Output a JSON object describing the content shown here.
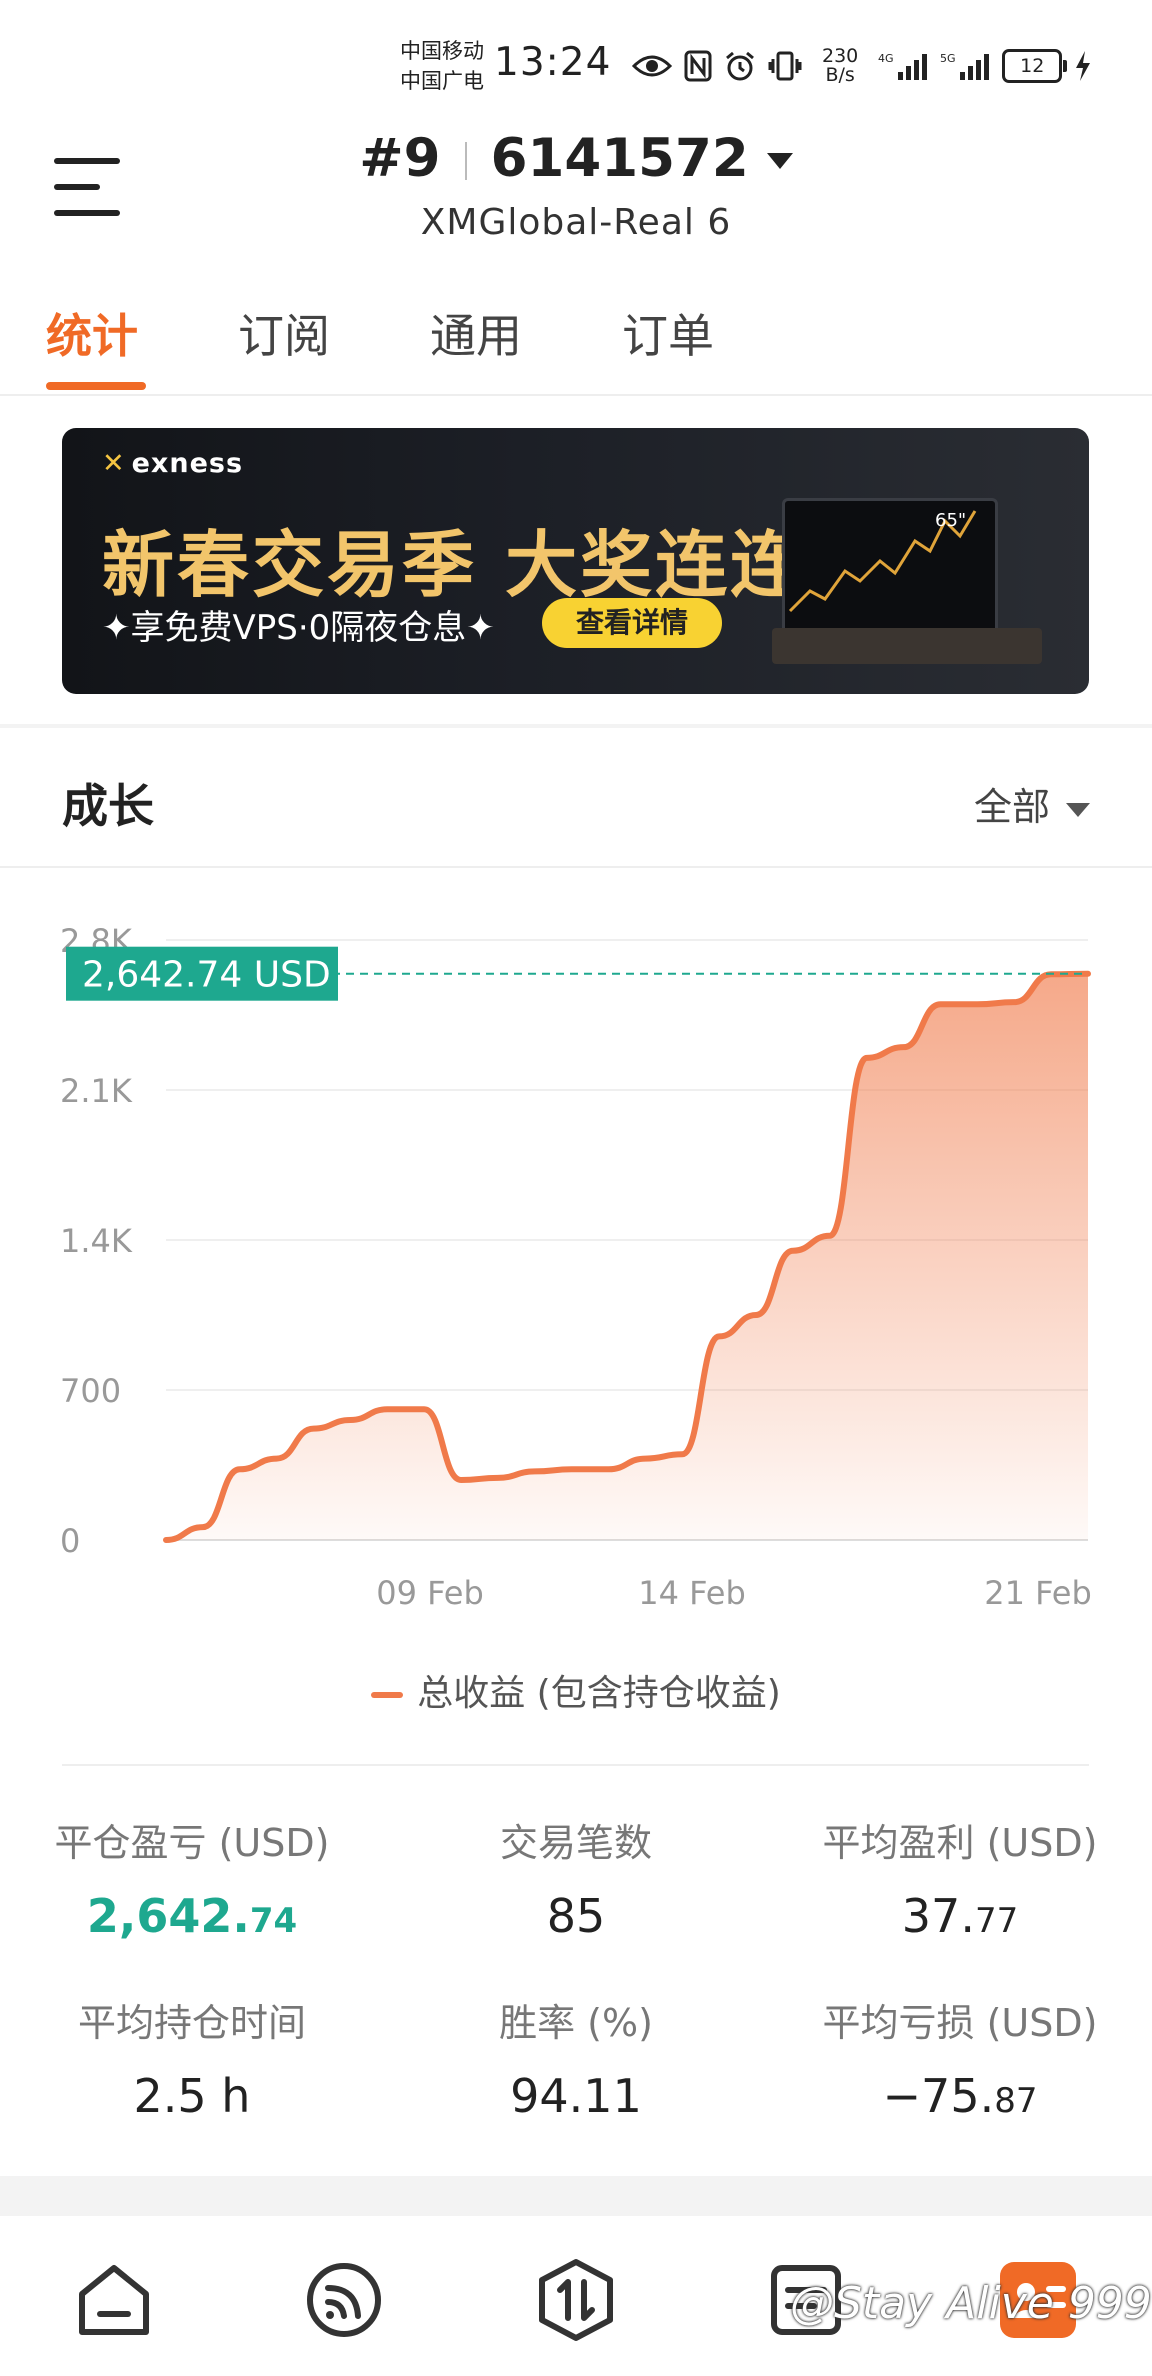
{
  "status_bar": {
    "carrier1": "中国移动",
    "carrier2": "中国广电",
    "time": "13:24",
    "net_speed_value": "230",
    "net_speed_unit": "B/s",
    "signal1": "4G",
    "signal2": "5G",
    "battery": "12"
  },
  "header": {
    "account_rank": "#9",
    "account_number": "6141572",
    "server": "XMGlobal-Real 6"
  },
  "tabs": [
    {
      "label": "统计",
      "active": true
    },
    {
      "label": "订阅",
      "active": false
    },
    {
      "label": "通用",
      "active": false
    },
    {
      "label": "订单",
      "active": false
    }
  ],
  "banner": {
    "brand": "exness",
    "title": "新春交易季 大奖连连抽",
    "subtitle": "✦享免费VPS·0隔夜仓息✦",
    "button": "查看详情",
    "tv_size": "65\""
  },
  "growth": {
    "title": "成长",
    "filter": "全部"
  },
  "chart_data": {
    "type": "area",
    "y_ticks": [
      "2.8K",
      "2.1K",
      "1.4K",
      "700",
      "0"
    ],
    "ylim": [
      0,
      2800
    ],
    "x_ticks": [
      "09 Feb",
      "14 Feb",
      "21 Feb"
    ],
    "current_label": "2,642.74 USD",
    "current_value": 2642.74,
    "series": [
      {
        "name": "总收益 (包含持仓收益)",
        "color": "#f07a4a",
        "values": [
          0,
          60,
          330,
          380,
          520,
          560,
          610,
          610,
          280,
          290,
          320,
          330,
          330,
          380,
          400,
          950,
          1050,
          1350,
          1420,
          2250,
          2300,
          2500,
          2500,
          2510,
          2640,
          2642.74
        ]
      }
    ]
  },
  "legend": {
    "label": "总收益 (包含持仓收益)"
  },
  "stats": {
    "closed_pnl": {
      "label": "平仓盈亏 (USD)",
      "int": "2,642.",
      "dec": "74"
    },
    "trades": {
      "label": "交易笔数",
      "int": "85",
      "dec": ""
    },
    "avg_profit": {
      "label": "平均盈利 (USD)",
      "int": "37.",
      "dec": "77"
    },
    "avg_hold": {
      "label": "平均持仓时间",
      "int": "2.5 h",
      "dec": ""
    },
    "win_rate": {
      "label": "胜率 (%)",
      "int": "94.11",
      "dec": ""
    },
    "avg_loss": {
      "label": "平均亏损 (USD)",
      "int": "−75.",
      "dec": "87"
    }
  },
  "watermark": "@Stay Alive 999",
  "colors": {
    "accent": "#f06a26",
    "profit_green": "#1ea88f",
    "chart_line": "#f07a4a"
  }
}
